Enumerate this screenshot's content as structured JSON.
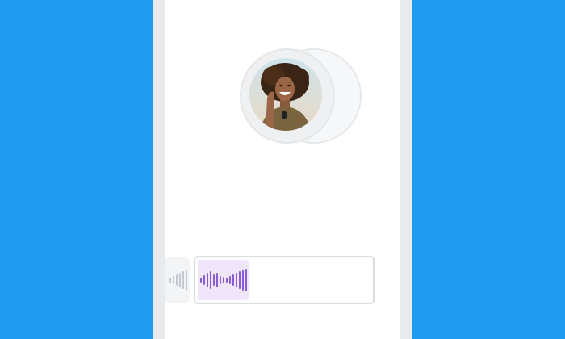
{
  "colors": {
    "background": "#1f9cf0",
    "waveform_active": "#8a5cd8",
    "waveform_inactive": "#c4c9cf",
    "chip_bg": "#efe6fb"
  },
  "icons": {
    "waveform_prev": "waveform-icon",
    "waveform_active": "waveform-icon"
  },
  "contact": {
    "avatar_alt": "avatar"
  }
}
